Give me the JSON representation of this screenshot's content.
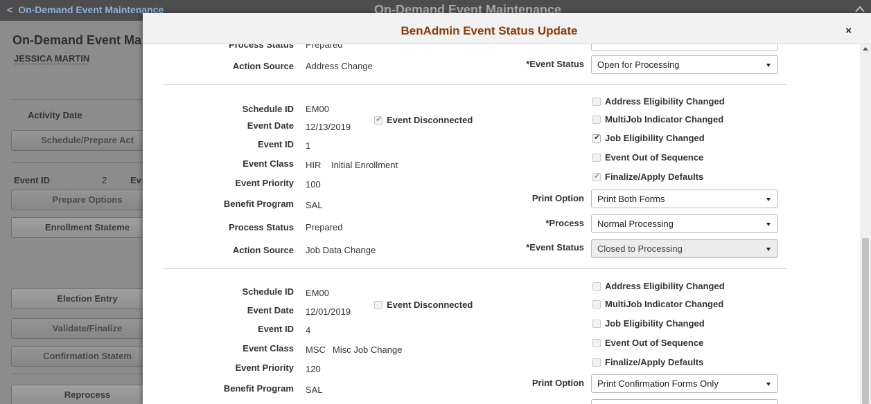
{
  "background": {
    "back_label": "On-Demand Event Maintenance",
    "header_title": "On-Demand Event Maintenance",
    "page_title": "On-Demand Event Ma",
    "employee_name": "JESSICA MARTIN",
    "activity_date_label": "Activity Date",
    "schedule_button": "Schedule/Prepare Act",
    "event_id_label": "Event ID",
    "event_id_value": "2",
    "ev_fragment": "Ev",
    "prepare_options_button": "Prepare Options",
    "enrollment_statement_button": "Enrollment Stateme",
    "election_entry_button": "Election Entry",
    "validate_finalize_button": "Validate/Finalize",
    "confirmation_statement_button": "Confirmation Statem",
    "reprocess_button": "Reprocess"
  },
  "modal": {
    "title": "BenAdmin Event Status Update",
    "close_label": "×",
    "top_partial": {
      "process_status_label": "Process Status",
      "process_status_value": "Prepared",
      "action_source_label": "Action Source",
      "action_source_value": "Address Change",
      "event_status_label": "*Event Status",
      "event_status_value": "Open for Processing"
    },
    "event1": {
      "schedule_id_label": "Schedule ID",
      "schedule_id_value": "EM00",
      "event_date_label": "Event Date",
      "event_date_value": "12/13/2019",
      "event_disconnected_label": "Event Disconnected",
      "event_id_label": "Event ID",
      "event_id_value": "1",
      "event_class_label": "Event Class",
      "event_class_code": "HIR",
      "event_class_desc": "Initial Enrollment",
      "event_priority_label": "Event Priority",
      "event_priority_value": "100",
      "benefit_program_label": "Benefit Program",
      "benefit_program_value": "SAL",
      "process_status_label": "Process Status",
      "process_status_value": "Prepared",
      "action_source_label": "Action Source",
      "action_source_value": "Job Data Change",
      "address_elig_label": "Address Eligibility Changed",
      "multijob_label": "MultiJob Indicator Changed",
      "job_elig_label": "Job Eligibility Changed",
      "out_of_seq_label": "Event Out of Sequence",
      "finalize_label": "Finalize/Apply Defaults",
      "print_option_label": "Print Option",
      "print_option_value": "Print Both Forms",
      "process_label": "*Process",
      "process_value": "Normal Processing",
      "event_status_label": "*Event Status",
      "event_status_value": "Closed to Processing"
    },
    "event2": {
      "schedule_id_label": "Schedule ID",
      "schedule_id_value": "EM00",
      "event_date_label": "Event Date",
      "event_date_value": "12/01/2019",
      "event_disconnected_label": "Event Disconnected",
      "event_id_label": "Event ID",
      "event_id_value": "4",
      "event_class_label": "Event Class",
      "event_class_code": "MSC",
      "event_class_desc": "Misc Job Change",
      "event_priority_label": "Event Priority",
      "event_priority_value": "120",
      "benefit_program_label": "Benefit Program",
      "benefit_program_value": "SAL",
      "address_elig_label": "Address Eligibility Changed",
      "multijob_label": "MultiJob Indicator Changed",
      "job_elig_label": "Job Eligibility Changed",
      "out_of_seq_label": "Event Out of Sequence",
      "finalize_label": "Finalize/Apply Defaults",
      "print_option_label": "Print Option",
      "print_option_value": "Print Confirmation Forms Only"
    }
  }
}
